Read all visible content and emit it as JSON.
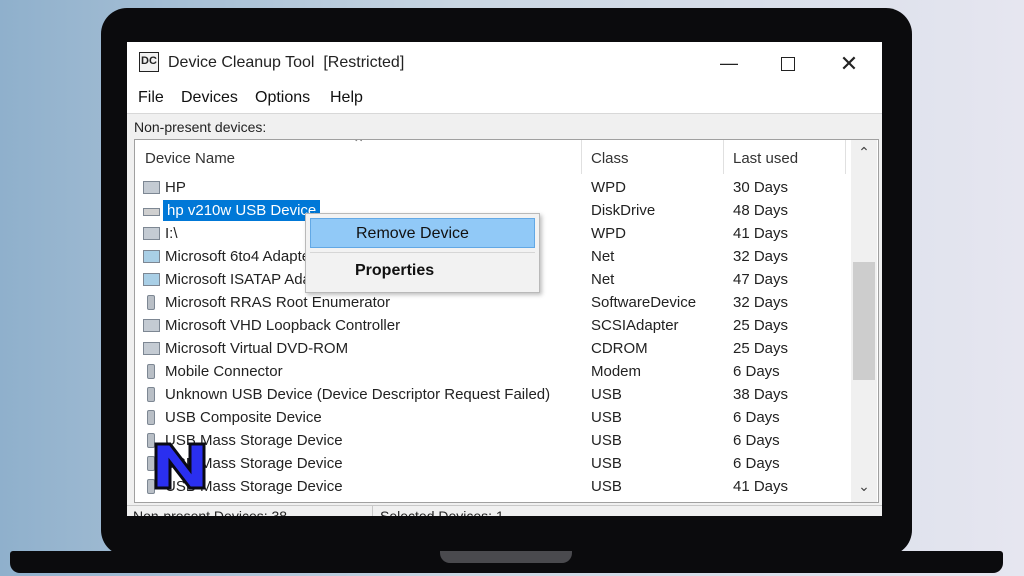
{
  "window": {
    "icon_text": "DC",
    "title": "Device Cleanup Tool",
    "title_suffix": "[Restricted]",
    "controls": {
      "minimize": "—",
      "close": "✕"
    }
  },
  "menu": [
    "File",
    "Devices",
    "Options",
    "Help"
  ],
  "section_label": "Non-present devices:",
  "columns": {
    "name": "Device Name",
    "class": "Class",
    "last_used": "Last used"
  },
  "rows": [
    {
      "name": "HP",
      "class": "WPD",
      "last_used": "30 Days",
      "icon": "portable-device-icon"
    },
    {
      "name": "hp v210w USB Device",
      "class": "DiskDrive",
      "last_used": "48 Days",
      "icon": "disk-drive-icon",
      "selected": true
    },
    {
      "name": "I:\\",
      "class": "WPD",
      "last_used": "41 Days",
      "icon": "portable-device-icon"
    },
    {
      "name": "Microsoft 6to4 Adapter",
      "class": "Net",
      "last_used": "32 Days",
      "icon": "network-adapter-icon"
    },
    {
      "name": "Microsoft ISATAP Adapter",
      "class": "Net",
      "last_used": "47 Days",
      "icon": "network-adapter-icon"
    },
    {
      "name": "Microsoft RRAS Root Enumerator",
      "class": "SoftwareDevice",
      "last_used": "32 Days",
      "icon": "software-device-icon"
    },
    {
      "name": "Microsoft VHD Loopback Controller",
      "class": "SCSIAdapter",
      "last_used": "25 Days",
      "icon": "scsi-adapter-icon"
    },
    {
      "name": "Microsoft Virtual DVD-ROM",
      "class": "CDROM",
      "last_used": "25 Days",
      "icon": "cdrom-icon"
    },
    {
      "name": "Mobile Connector",
      "class": "Modem",
      "last_used": "6 Days",
      "icon": "modem-icon"
    },
    {
      "name": "Unknown USB Device (Device Descriptor Request Failed)",
      "class": "USB",
      "last_used": "38 Days",
      "icon": "usb-icon"
    },
    {
      "name": "USB Composite Device",
      "class": "USB",
      "last_used": "6 Days",
      "icon": "usb-icon"
    },
    {
      "name": "USB Mass Storage Device",
      "class": "USB",
      "last_used": "6 Days",
      "icon": "usb-icon"
    },
    {
      "name": "USB Mass Storage Device",
      "class": "USB",
      "last_used": "6 Days",
      "icon": "usb-icon"
    },
    {
      "name": "USB Mass Storage Device",
      "class": "USB",
      "last_used": "41 Days",
      "icon": "usb-icon"
    }
  ],
  "context_menu": {
    "remove": "Remove Device",
    "properties": "Properties"
  },
  "status": {
    "left": "Non-present Devices: 38",
    "right": "Selected Devices: 1"
  }
}
